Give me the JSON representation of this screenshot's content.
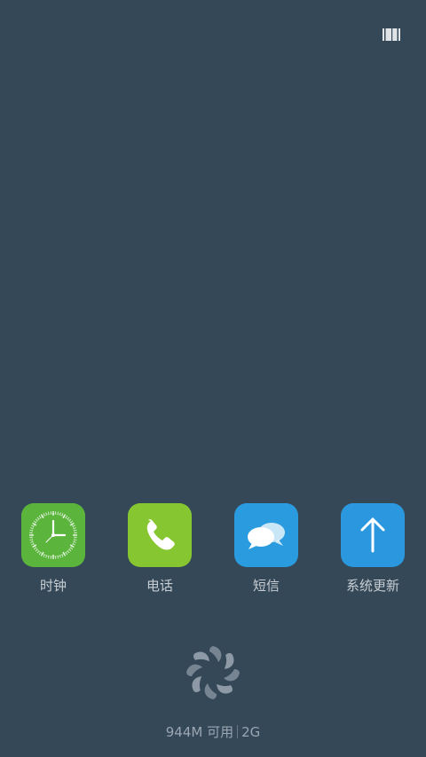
{
  "home": {
    "apps": [
      {
        "label": "时钟",
        "icon": "clock-icon",
        "color": "#5bb53d"
      },
      {
        "label": "电话",
        "icon": "phone-icon",
        "color": "#86c731"
      },
      {
        "label": "短信",
        "icon": "chat-bubbles-icon",
        "color": "#2b9be0"
      },
      {
        "label": "系统更新",
        "icon": "up-arrow-icon",
        "color": "#2a97df"
      }
    ],
    "status": {
      "memory": "944M 可用",
      "network": "2G"
    },
    "top_right_icon": "recent-apps-icon",
    "cleaner_icon": "memory-cleaner-icon"
  }
}
